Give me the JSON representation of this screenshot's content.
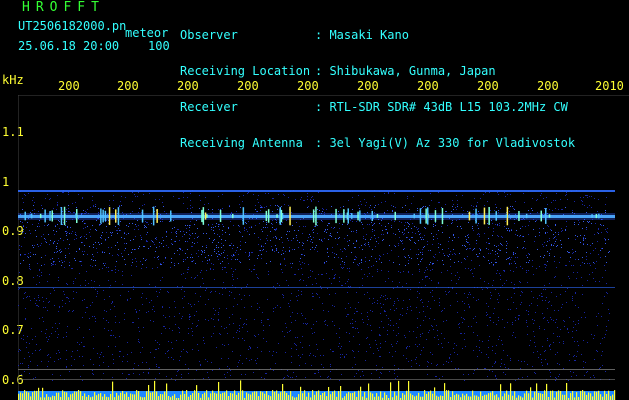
{
  "header": {
    "brand": "HROFFT",
    "file_name": "UT2506182000.pn",
    "file_suffix": "meteor",
    "stamp": "25.06.18 20:00    100"
  },
  "info": [
    {
      "label": "Observer",
      "value": ": Masaki Kano"
    },
    {
      "label": "Receiving Location",
      "value": ": Shibukawa, Gunma, Japan"
    },
    {
      "label": "Receiver",
      "value": ": RTL-SDR SDR# 43dB L15 103.2MHz CW"
    },
    {
      "label": "Receiving Antenna",
      "value": ": 3el Yagi(V) Az 330 for Vladivostok"
    }
  ],
  "axis": {
    "unit": "kHz",
    "y_ticks": [
      "1.1",
      "1",
      "0.9",
      "0.8",
      "0.7",
      "0.6"
    ],
    "x_ticks": [
      "200",
      "200",
      "200",
      "200",
      "200",
      "200",
      "200",
      "200",
      "200",
      "2010"
    ]
  },
  "colors": {
    "text_green": "#33ff33",
    "text_cyan": "#33ffff",
    "text_yellow": "#ffff33",
    "echo_line": "#5fd3ff",
    "count_bars": "#ffff33",
    "count_base": "#1e88ff"
  }
}
